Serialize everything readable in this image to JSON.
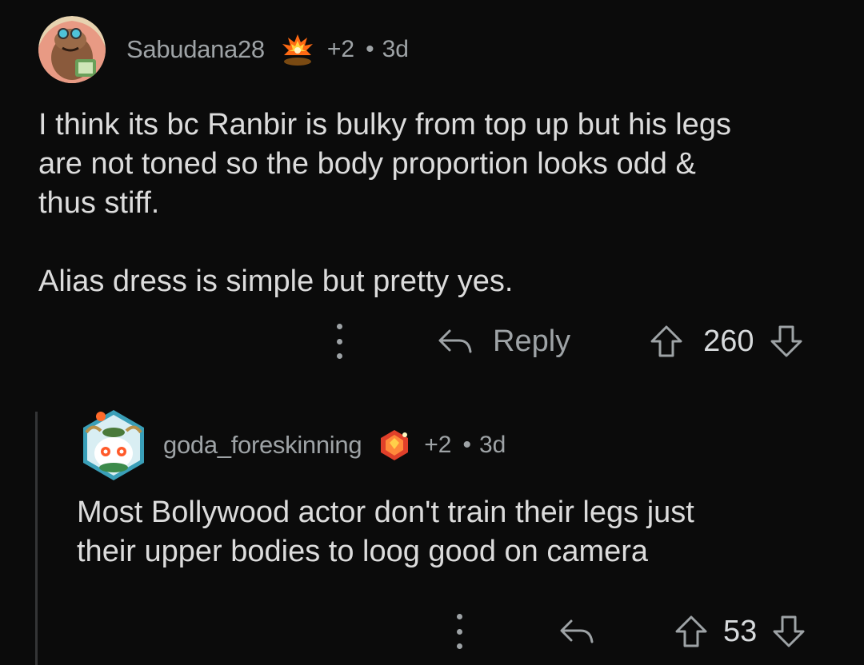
{
  "comments": [
    {
      "username": "Sabudana28",
      "award_count": "+2",
      "separator": "•",
      "age": "3d",
      "body": "I think its bc Ranbir is bulky from top up but his legs\nare not toned so the body proportion looks odd &\nthus stiff.\n\nAlias dress is simple but pretty yes.",
      "reply_label": "Reply",
      "score": "260",
      "award_icon": "fire-award-icon",
      "avatar_icon": "snoo-avatar-icon"
    },
    {
      "username": "goda_foreskinning",
      "award_count": "+2",
      "separator": "•",
      "age": "3d",
      "body": "Most Bollywood actor don't train their legs just\ntheir upper bodies to loog good on camera",
      "score": "53",
      "award_icon": "gem-award-icon",
      "avatar_icon": "nft-hex-avatar-icon"
    }
  ],
  "colors": {
    "background": "#0b0b0b",
    "text": "#dcdcdc",
    "meta": "#9ea3a6",
    "thread_line": "#343536"
  }
}
